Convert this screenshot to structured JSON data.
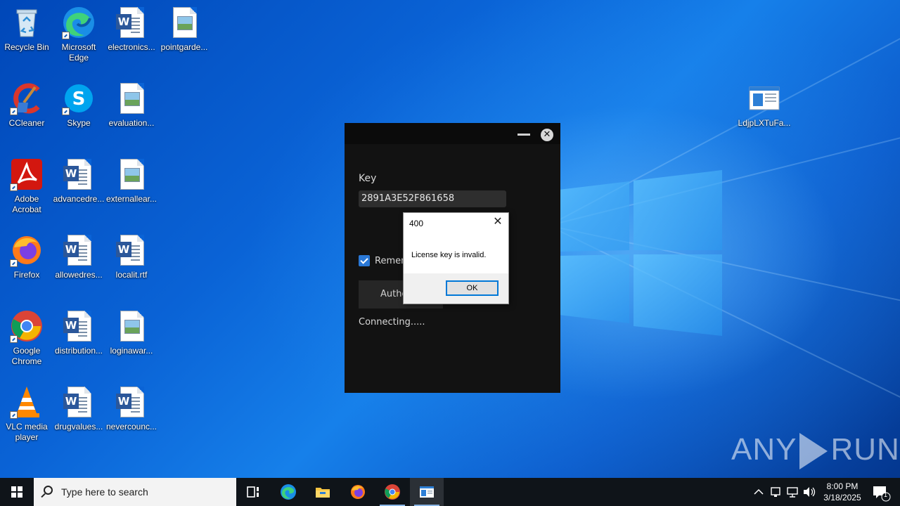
{
  "desktop": {
    "icons": [
      {
        "label": "Recycle Bin"
      },
      {
        "label": "Microsoft Edge"
      },
      {
        "label": "electronics..."
      },
      {
        "label": "pointgarde..."
      },
      {
        "label": "CCleaner"
      },
      {
        "label": "Skype"
      },
      {
        "label": "evaluation..."
      },
      {
        "label": "Adobe Acrobat"
      },
      {
        "label": "advancedre..."
      },
      {
        "label": "externallear..."
      },
      {
        "label": "Firefox"
      },
      {
        "label": "allowedres..."
      },
      {
        "label": "localit.rtf"
      },
      {
        "label": "Google Chrome"
      },
      {
        "label": "distribution..."
      },
      {
        "label": "loginawar..."
      },
      {
        "label": "VLC media player"
      },
      {
        "label": "drugvalues..."
      },
      {
        "label": "nevercounc..."
      },
      {
        "label": "LdjpLXTuFa..."
      }
    ]
  },
  "app_window": {
    "key_label": "Key",
    "key_value": "2891A3E52F861658",
    "remember_label": "Remem",
    "remember_checked": true,
    "authorize_label": "Autho",
    "status_text": "Connecting....."
  },
  "message_box": {
    "title": "400",
    "message": "License key is invalid.",
    "ok_label": "OK"
  },
  "watermark": {
    "left": "ANY",
    "right": "RUN"
  },
  "taskbar": {
    "search_placeholder": "Type here to search",
    "time": "8:00 PM",
    "date": "3/18/2025",
    "notification_count": "1"
  },
  "colors": {
    "accent": "#0078d7",
    "app_bg": "#121212",
    "taskbar_bg": "#0f1419"
  }
}
